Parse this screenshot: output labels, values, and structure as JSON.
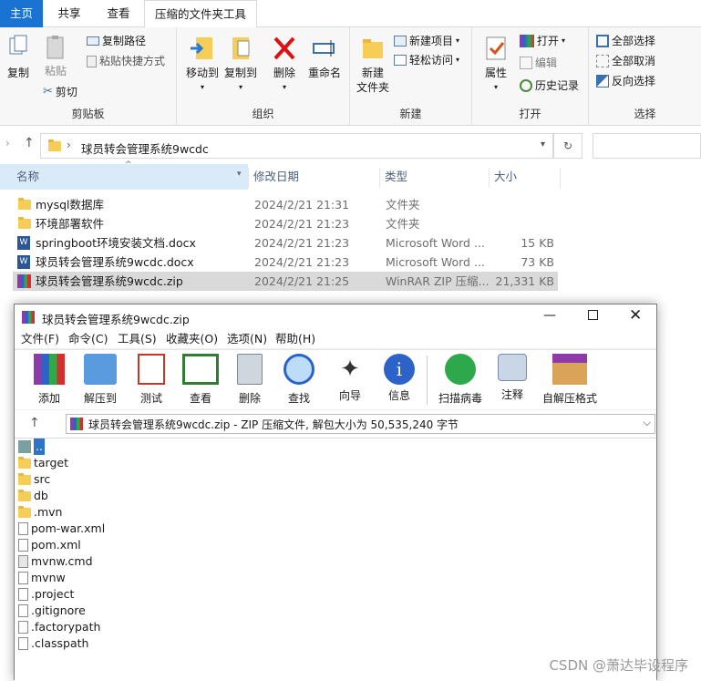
{
  "ribbon": {
    "tabs": [
      "主页",
      "共享",
      "查看",
      "压缩的文件夹工具"
    ],
    "clipboard": {
      "copy": "复制",
      "paste": "粘贴",
      "copy_path": "复制路径",
      "paste_shortcut": "粘贴快捷方式",
      "cut": "剪切",
      "group": "剪贴板"
    },
    "organize": {
      "move_to": "移动到",
      "copy_to": "复制到",
      "delete": "删除",
      "rename": "重命名",
      "group": "组织"
    },
    "new": {
      "new_folder_1": "新建",
      "new_folder_2": "文件夹",
      "new_item": "新建项目",
      "easy_access": "轻松访问",
      "group": "新建"
    },
    "open": {
      "properties": "属性",
      "open": "打开",
      "edit": "编辑",
      "history": "历史记录",
      "group": "打开"
    },
    "select": {
      "select_all": "全部选择",
      "select_none": "全部取消",
      "invert": "反向选择",
      "group": "选择"
    }
  },
  "address": {
    "path": "球员转会管理系统9wcdc",
    "sep": "›"
  },
  "columns": {
    "name": "名称",
    "date": "修改日期",
    "type": "类型",
    "size": "大小"
  },
  "files": [
    {
      "name": "mysql数据库",
      "date": "2024/2/21 21:31",
      "type": "文件夹",
      "size": ""
    },
    {
      "name": "环境部署软件",
      "date": "2024/2/21 21:23",
      "type": "文件夹",
      "size": ""
    },
    {
      "name": "springboot环境安装文档.docx",
      "date": "2024/2/21 21:23",
      "type": "Microsoft Word ...",
      "size": "15 KB"
    },
    {
      "name": "球员转会管理系统9wcdc.docx",
      "date": "2024/2/21 21:23",
      "type": "Microsoft Word ...",
      "size": "73 KB"
    },
    {
      "name": "球员转会管理系统9wcdc.zip",
      "date": "2024/2/21 21:25",
      "type": "WinRAR ZIP 压缩...",
      "size": "21,331 KB"
    }
  ],
  "rar": {
    "title": "球员转会管理系统9wcdc.zip",
    "menu": [
      "文件(F)",
      "命令(C)",
      "工具(S)",
      "收藏夹(O)",
      "选项(N)",
      "帮助(H)"
    ],
    "tools": [
      "添加",
      "解压到",
      "测试",
      "查看",
      "删除",
      "查找",
      "向导",
      "信息",
      "扫描病毒",
      "注释",
      "自解压格式"
    ],
    "path": "球员转会管理系统9wcdc.zip - ZIP 压缩文件, 解包大小为 50,535,240 字节",
    "items": [
      "..",
      "target",
      "src",
      "db",
      ".mvn",
      "pom-war.xml",
      "pom.xml",
      "mvnw.cmd",
      "mvnw",
      ".project",
      ".gitignore",
      ".factorypath",
      ".classpath"
    ]
  },
  "watermark": "CSDN @萧达毕设程序",
  "colors": {
    "accent": "#1a73d2",
    "selection": "#cce8ff"
  }
}
